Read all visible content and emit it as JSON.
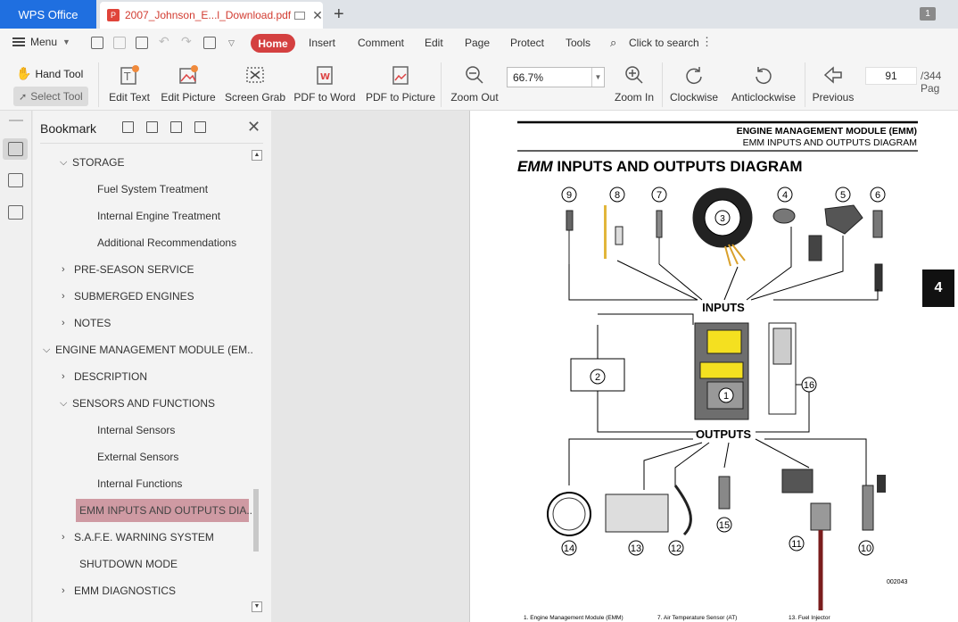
{
  "titlebar": {
    "app_tab": "WPS Office",
    "doc_tab": "2007_Johnson_E...l_Download.pdf",
    "window_count": "1"
  },
  "menu": {
    "menu_label": "Menu",
    "home": "Home",
    "items": [
      "Insert",
      "Comment",
      "Edit",
      "Page",
      "Protect",
      "Tools"
    ],
    "search": "Click to search"
  },
  "toolbar": {
    "hand_tool": "Hand Tool",
    "select_tool": "Select Tool",
    "edit_text": "Edit Text",
    "edit_picture": "Edit Picture",
    "screen_grab": "Screen Grab",
    "pdf_to_word": "PDF to Word",
    "pdf_to_picture": "PDF to Picture",
    "zoom_out": "Zoom Out",
    "zoom_value": "66.7%",
    "zoom_in": "Zoom In",
    "clockwise": "Clockwise",
    "anticlockwise": "Anticlockwise",
    "previous": "Previous",
    "page_number": "91",
    "page_total": "/344 Pag"
  },
  "bookmark": {
    "title": "Bookmark",
    "items": [
      {
        "label": "STORAGE",
        "chevron": "down"
      },
      {
        "label": "Fuel System Treatment",
        "chevron": ""
      },
      {
        "label": "Internal Engine Treatment",
        "chevron": ""
      },
      {
        "label": "Additional Recommendations",
        "chevron": ""
      },
      {
        "label": "PRE-SEASON SERVICE",
        "chevron": "right"
      },
      {
        "label": "SUBMERGED ENGINES",
        "chevron": "right"
      },
      {
        "label": "NOTES",
        "chevron": "right"
      },
      {
        "label": "ENGINE MANAGEMENT MODULE (EM..",
        "chevron": "down"
      },
      {
        "label": "DESCRIPTION",
        "chevron": "right"
      },
      {
        "label": "SENSORS AND FUNCTIONS",
        "chevron": "down"
      },
      {
        "label": "Internal Sensors",
        "chevron": ""
      },
      {
        "label": "External Sensors",
        "chevron": ""
      },
      {
        "label": "Internal Functions",
        "chevron": ""
      },
      {
        "label": "EMM INPUTS AND OUTPUTS DIA...",
        "chevron": ""
      },
      {
        "label": "S.A.F.E. WARNING SYSTEM",
        "chevron": "right"
      },
      {
        "label": "SHUTDOWN MODE",
        "chevron": ""
      },
      {
        "label": "EMM DIAGNOSTICS",
        "chevron": "right"
      }
    ]
  },
  "document": {
    "header_line1": "ENGINE MANAGEMENT MODULE (EMM)",
    "header_line2": "EMM INPUTS AND OUTPUTS DIAGRAM",
    "heading_emm": "EMM",
    "heading_rest": " INPUTS AND OUTPUTS DIAGRAM",
    "inputs_label": "INPUTS",
    "outputs_label": "OUTPUTS",
    "figure_code": "002043",
    "chapter_tab": "4",
    "callouts_top": [
      "9",
      "8",
      "7",
      "3",
      "4",
      "5",
      "6"
    ],
    "callouts_mid": [
      "2",
      "1",
      "16"
    ],
    "callouts_bottom": [
      "14",
      "13",
      "12",
      "15",
      "11",
      "10"
    ],
    "caption_1": "1. Engine Management Module (EMM)",
    "caption_7": "7. Air Temperature Sensor (AT)",
    "caption_13": "13. Fuel Injector"
  }
}
